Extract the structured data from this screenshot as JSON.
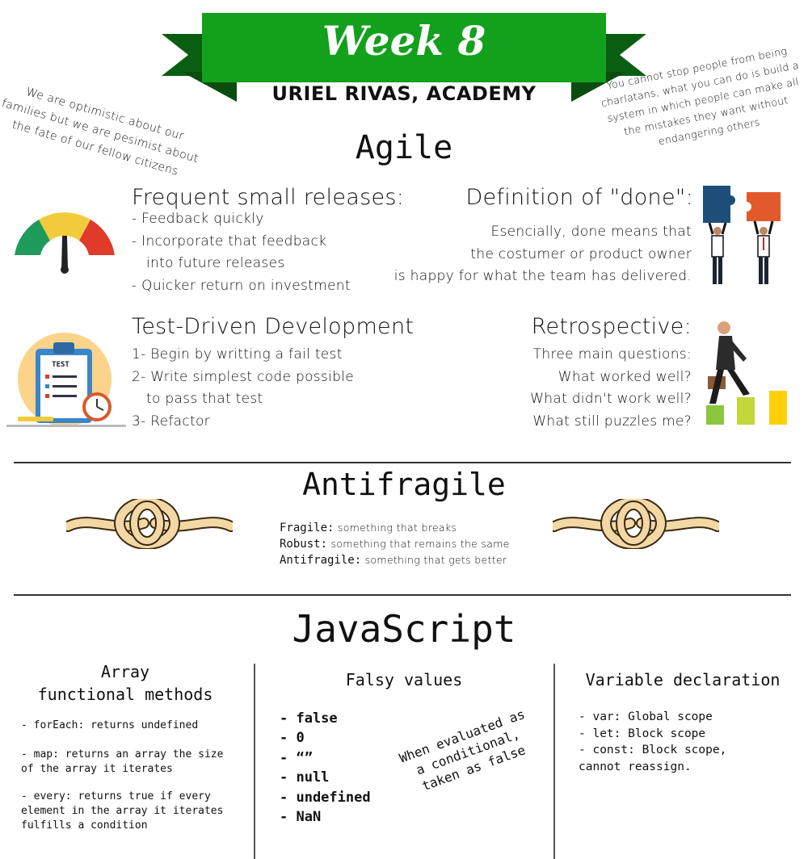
{
  "header": {
    "title": "Week 8",
    "subtitle": "URIEL RIVAS, ACADEMY",
    "quote_left": "We are optimistic about our families but we are pesimist about the fate of our fellow citizens",
    "quote_right": "You cannot stop people from being charlatans, what you can do is build a system in which people can make all the mistakes they want without endangering others"
  },
  "agile": {
    "title": "Agile",
    "frequent": {
      "heading": "Frequent small releases:",
      "items": [
        "- Feedback quickly",
        "- Incorporate that feedback",
        "into future releases",
        "- Quicker return on investment"
      ]
    },
    "done": {
      "heading": "Definition of \"done\":",
      "lines": [
        "Esencially, done means that",
        "the costumer or product owner",
        "is happy for what the team has delivered."
      ]
    },
    "tdd": {
      "heading": "Test-Driven Development",
      "items": [
        "1- Begin by writting a fail test",
        "2- Write simplest code possible",
        "to pass that test",
        "3- Refactor"
      ],
      "icon_label": "TEST"
    },
    "retro": {
      "heading": "Retrospective:",
      "lines": [
        "Three main questions:",
        "What worked well?",
        "What didn't work well?",
        "What still puzzles me?"
      ]
    }
  },
  "antifragile": {
    "title": "Antifragile",
    "items": [
      {
        "term": "Fragile:",
        "desc": "something that breaks"
      },
      {
        "term": "Robust:",
        "desc": "something that remains the same"
      },
      {
        "term": "Antifragile:",
        "desc": "something that gets better"
      }
    ]
  },
  "javascript": {
    "title": "JavaScript",
    "array": {
      "heading_line1": "Array",
      "heading_line2": "functional methods",
      "items": [
        "- forEach: returns undefined",
        "- map: returns an array the size of the array it iterates",
        "- every: returns true if every element in the array it iterates fulfills a condition"
      ]
    },
    "falsy": {
      "heading": "Falsy values",
      "items": [
        "- false",
        "- 0",
        "- “”",
        "- null",
        "- undefined",
        "- NaN"
      ],
      "note_line1": "When evaluated as",
      "note_line2": "a conditional,",
      "note_line3": "taken as false"
    },
    "variables": {
      "heading": "Variable declaration",
      "items": [
        "- var: Global scope",
        "- let: Block scope",
        "- const: Block scope,",
        "cannot reassign."
      ]
    }
  },
  "colors": {
    "banner_green": "#13a01c",
    "banner_dark": "#0a5e12",
    "gauge_green": "#1e9a5a",
    "gauge_yellow": "#f2cb3c",
    "gauge_red": "#e03a2a",
    "rope": "#f3d8a6"
  }
}
